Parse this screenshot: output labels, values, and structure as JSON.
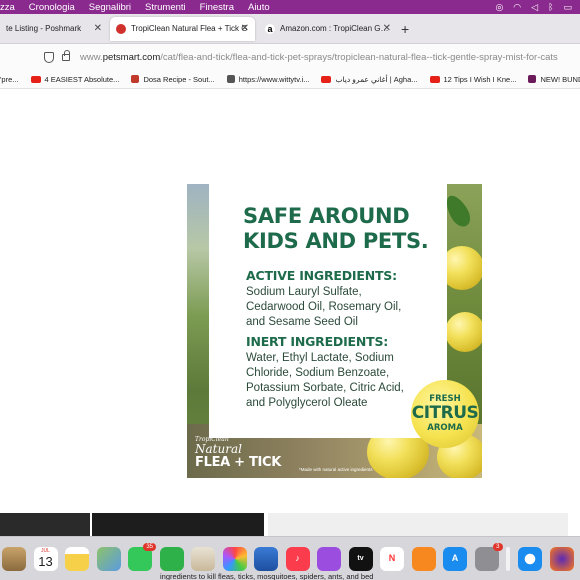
{
  "menubar": {
    "items": [
      "zza",
      "Cronologia",
      "Segnalibri",
      "Strumenti",
      "Finestra",
      "Aiuto"
    ]
  },
  "tabs": [
    {
      "title": "te Listing - Poshmark",
      "active": false
    },
    {
      "title": "TropiClean Natural Flea + Tick G",
      "active": true
    },
    {
      "title": "Amazon.com : TropiClean Gentle",
      "active": false
    }
  ],
  "urlbar": {
    "prefix": "www.",
    "domain": "petsmart.com",
    "path": "/cat/flea-and-tick/flea-and-tick-pet-sprays/tropiclean-natural-flea--tick-gentle-spray-mist-for-cats"
  },
  "bookmarks": [
    {
      "label": "'pre...",
      "icon": "none"
    },
    {
      "label": "4 EASIEST Absolute...",
      "icon": "youtube-icon"
    },
    {
      "label": "Dosa Recipe - Sout...",
      "icon": "recipe-icon"
    },
    {
      "label": "https://www.wittytv.i...",
      "icon": "w-icon"
    },
    {
      "label": "أغاني عمرو دياب | Agha...",
      "icon": "youtube-icon"
    },
    {
      "label": "12 Tips I Wish I Kne...",
      "icon": "youtube-icon"
    },
    {
      "label": "NEW! BUNDLE of",
      "icon": "bundle-icon"
    }
  ],
  "product": {
    "headline_line1": "SAFE AROUND",
    "headline_line2": "KIDS AND PETS.",
    "active_heading": "ACTIVE INGREDIENTS:",
    "active_lines": [
      "Sodium Lauryl Sulfate,",
      "Cedarwood Oil, Rosemary Oil,",
      "and Sesame Seed Oil"
    ],
    "inert_heading": "INERT INGREDIENTS:",
    "inert_lines": [
      "Water, Ethyl Lactate, Sodium",
      "Chloride, Sodium Benzoate,",
      "Potassium Sorbate, Citric Acid,",
      "and Polyglycerol Oleate"
    ],
    "badge_top": "FRESH",
    "badge_main": "CITRUS",
    "badge_bottom": "AROMA",
    "brand_small": "TropiClean",
    "brand_natural": "Natural",
    "brand_flea": "FLEA + TICK",
    "footnote": "*Made with natural active ingredients"
  },
  "dock": {
    "calendar_month": "JUL",
    "calendar_day": "13",
    "messages_badge": "35",
    "settings_badge": "3",
    "caption": "ingredients to kill fleas, ticks, mosquitoes, spiders, ants, and bed"
  },
  "colors": {
    "menubar": "#8a2a8e",
    "brand_green": "#1d6b4b"
  }
}
